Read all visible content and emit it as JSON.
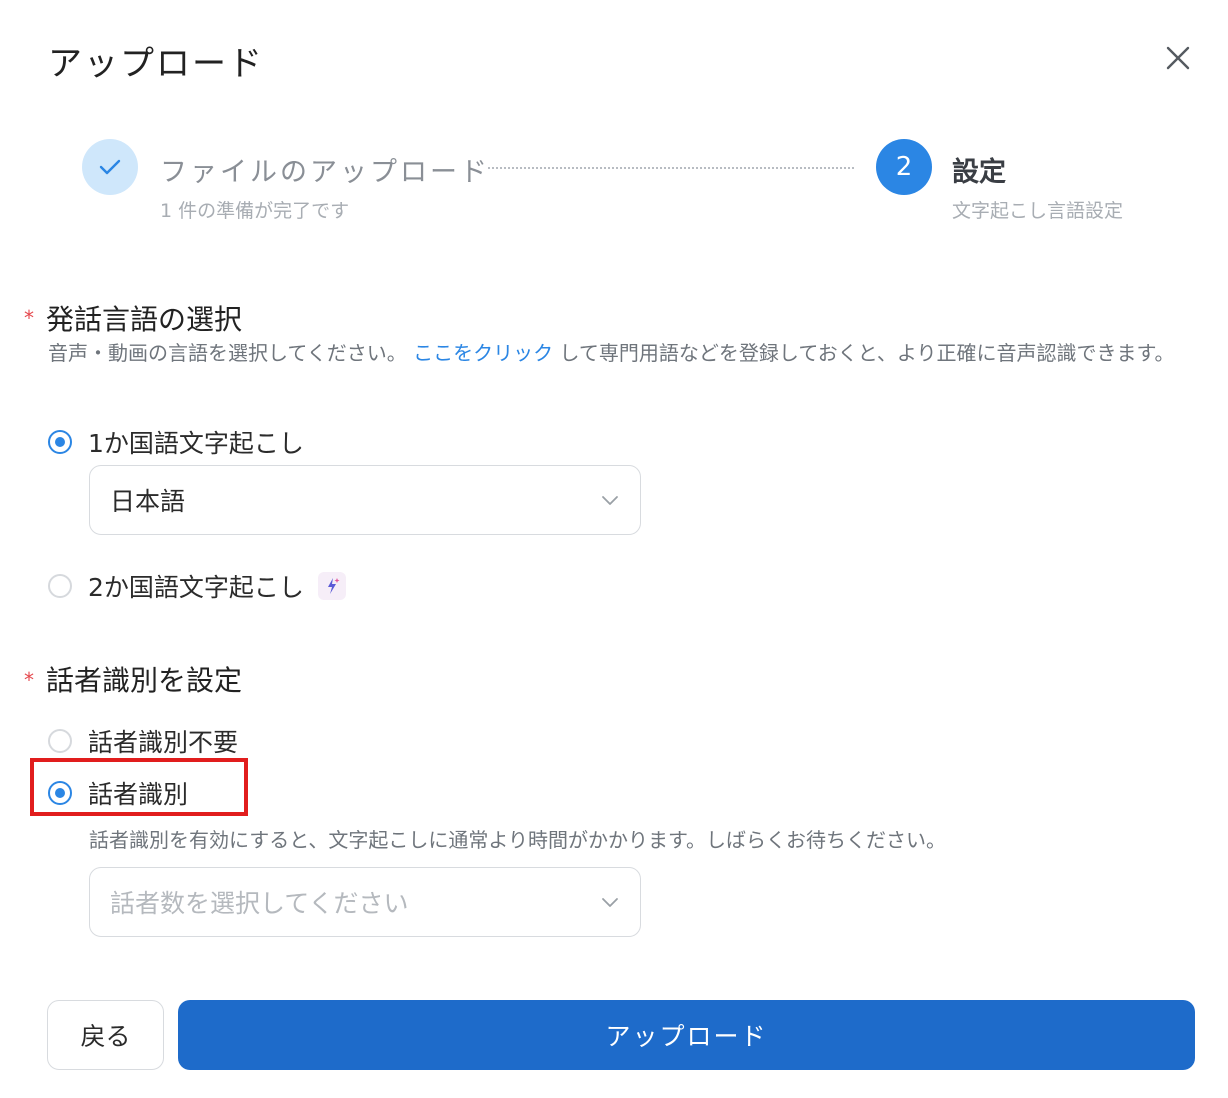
{
  "dialog": {
    "title": "アップロード",
    "close_icon": "close-icon"
  },
  "stepper": {
    "step1": {
      "title": "ファイルのアップロード",
      "subtitle": "1 件の準備が完了です",
      "state": "completed",
      "icon": "check-icon"
    },
    "step2": {
      "number": "2",
      "title": "設定",
      "subtitle": "文字起こし言語設定",
      "state": "active"
    }
  },
  "language_section": {
    "title": "発話言語の選択",
    "required_mark": "*",
    "description_before": "音声・動画の言語を選択してください。",
    "description_link": "ここをクリック",
    "description_after": "して専門用語などを登録しておくと、より正確に音声認識できます。",
    "options": [
      {
        "label": "1か国語文字起こし",
        "checked": true
      },
      {
        "label": "2か国語文字起こし",
        "checked": false,
        "badge_icon": "sparkle-icon"
      }
    ],
    "language_select": {
      "value": "日本語",
      "icon": "chevron-down-icon"
    }
  },
  "speaker_section": {
    "title": "話者識別を設定",
    "required_mark": "*",
    "options": [
      {
        "label": "話者識別不要",
        "checked": false
      },
      {
        "label": "話者識別",
        "checked": true
      }
    ],
    "hint": "話者識別を有効にすると、文字起こしに通常より時間がかかります。しばらくお待ちください。",
    "speaker_count_select": {
      "placeholder": "話者数を選択してください",
      "icon": "chevron-down-icon"
    }
  },
  "footer": {
    "back_label": "戻る",
    "upload_label": "アップロード"
  },
  "colors": {
    "accent": "#2b86e4",
    "primary_button": "#1e6bca",
    "step_done_bg": "#cfe7fb",
    "required_star": "#e5484d",
    "highlight_border": "#e11d1d"
  }
}
